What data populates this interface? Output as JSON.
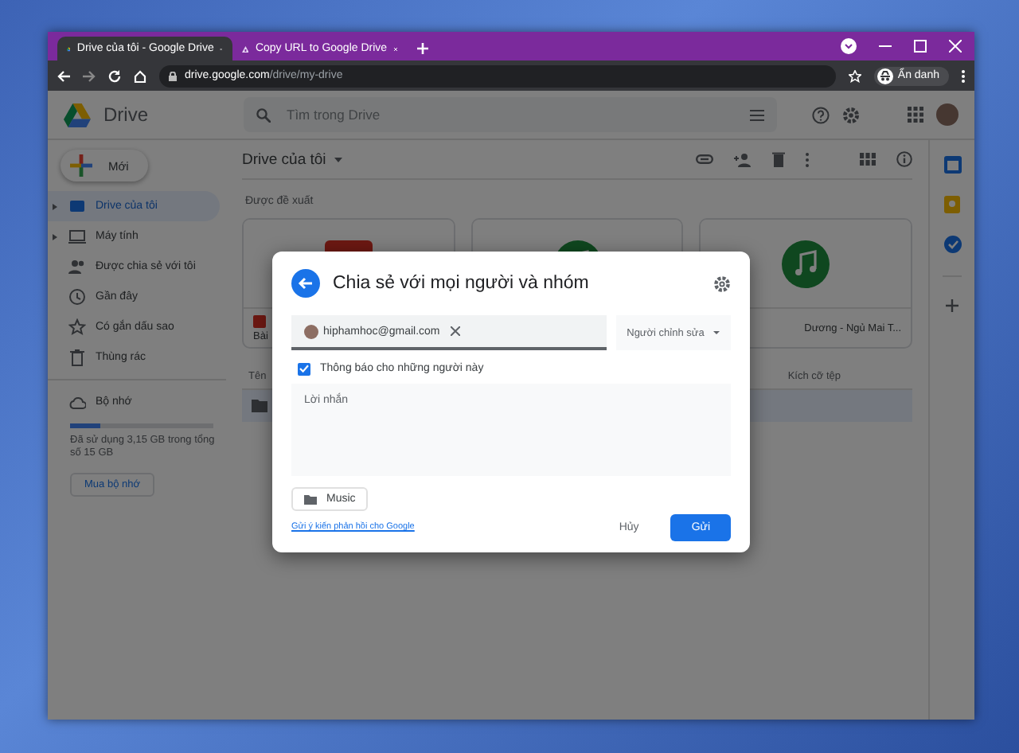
{
  "browser": {
    "tabs": [
      {
        "title": "Drive của tôi - Google Drive",
        "selected": true
      },
      {
        "title": "Copy URL to Google Drive",
        "selected": false
      }
    ],
    "address": {
      "domain": "drive.google.com",
      "path": "/drive/my-drive"
    },
    "profile": "Ẩn danh"
  },
  "drive": {
    "app_name": "Drive",
    "search": {
      "placeholder": "Tìm trong Drive"
    },
    "new_button": "Mới",
    "sidebar": {
      "items": [
        {
          "label": "Drive của tôi",
          "selected": true,
          "expandable": true
        },
        {
          "label": "Máy tính",
          "selected": false,
          "expandable": true
        },
        {
          "label": "Được chia sẻ với tôi",
          "selected": false,
          "expandable": false
        },
        {
          "label": "Gần đây",
          "selected": false,
          "expandable": false
        },
        {
          "label": "Có gắn dấu sao",
          "selected": false,
          "expandable": false
        },
        {
          "label": "Thùng rác",
          "selected": false,
          "expandable": false
        }
      ]
    },
    "storage": {
      "label": "Bộ nhớ",
      "level": 0.21,
      "usage": "Đã sử dụng 3,15 GB trong tổng số 15 GB",
      "button": "Mua bộ nhớ"
    },
    "main": {
      "title": "Drive của tôi",
      "suggested_label": "Được đề xuất",
      "cards": [
        {
          "kind": "document",
          "title": "Bài"
        },
        {
          "kind": "audio"
        },
        {
          "kind": "audio",
          "title": "Dương - Ngủ Mai T..."
        }
      ],
      "columns": [
        "Tên",
        "Kích cỡ tệp"
      ]
    }
  },
  "dialog": {
    "title": "Chia sẻ với mọi người và nhóm",
    "recipient": "hiphamhoc@gmail.com",
    "role": "Người chỉnh sửa",
    "notify": {
      "label": "Thông báo cho những người này",
      "checked": true
    },
    "message": {
      "placeholder": "Lời nhắn"
    },
    "attachment": "Music",
    "feedback_link": "Gửi ý kiến phản hồi cho Google",
    "cancel": "Hủy",
    "send": "Gửi"
  }
}
